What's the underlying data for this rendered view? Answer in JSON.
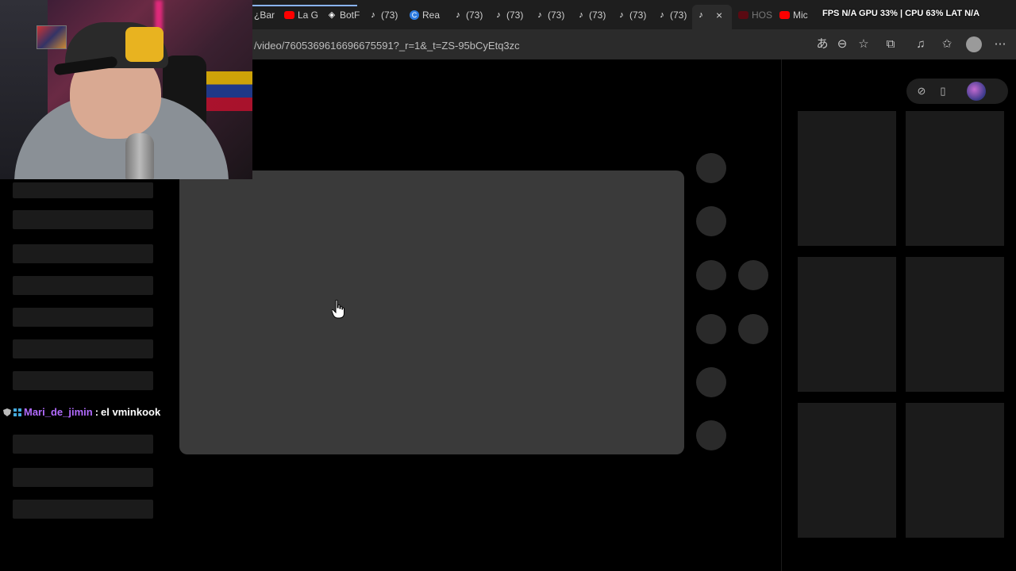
{
  "browser": {
    "tabs": [
      {
        "label": "¿Bar",
        "icon": "yt-icon"
      },
      {
        "label": "La G",
        "icon": "yt-icon"
      },
      {
        "label": "BotF",
        "icon": "bot-icon"
      },
      {
        "label": "(73)",
        "icon": "tiktok-icon"
      },
      {
        "label": "Rea",
        "icon": "copilot-icon"
      },
      {
        "label": "(73)",
        "icon": "tiktok-icon"
      },
      {
        "label": "(73)",
        "icon": "tiktok-icon"
      },
      {
        "label": "(73)",
        "icon": "tiktok-icon"
      },
      {
        "label": "(73)",
        "icon": "tiktok-icon"
      },
      {
        "label": "(73)",
        "icon": "tiktok-icon"
      },
      {
        "label": "(73)",
        "icon": "tiktok-icon"
      }
    ],
    "active_tab_close": "×",
    "more_tabs": [
      {
        "label": "HOS",
        "icon": "yt-icon"
      },
      {
        "label": "Mic",
        "icon": "yt-icon"
      }
    ],
    "url": "/video/7605369616696675591?_r=1&_t=ZS-95bCyEtq3zc"
  },
  "overlay": {
    "stats": "FPS N/A   GPU 33%  | CPU 63%   LAT N/A"
  },
  "chat": {
    "username": "Mari_de_jimin",
    "separator": ":",
    "message": "el vminkook"
  },
  "colors": {
    "accent": "#b26bff",
    "video_placeholder": "#3a3a3a",
    "skeleton": "#1b1b1b"
  }
}
